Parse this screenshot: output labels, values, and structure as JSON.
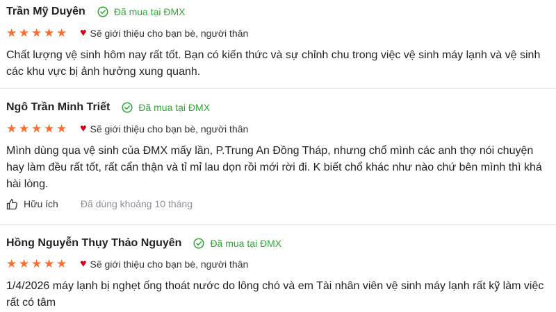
{
  "reviews": [
    {
      "name": "Trần Mỹ Duyên",
      "verified": "Đã mua tại ĐMX",
      "rating": 5,
      "recommend": "Sẽ giới thiệu cho bạn bè, người thân",
      "text": "Chất lượng vệ sinh hôm nay rất tốt. Bạn có kiến thức và sự chỉnh chu trong việc vệ sinh máy lạnh và vệ sinh\ncác khu vực bị ảnh hưởng xung quanh."
    },
    {
      "name": "Ngô Trần Minh Triết",
      "verified": "Đã mua tại ĐMX",
      "rating": 5,
      "recommend": "Sẽ giới thiệu cho bạn bè, người thân",
      "text": "Mình dùng qua vệ sinh của ĐMX mấy lần, P.Trung An Đồng Tháp, nhưng chổ mình các anh thợ nói chuyện hay làm đều rất tốt, rất cẩn thận và tỉ mỉ lau dọn rồi mới rời đi. K biết chổ khác như nào chứ bên mình thì khá hài lòng.",
      "helpful_label": "Hữu ích",
      "usage": "Đã dùng khoảng 10 tháng"
    },
    {
      "name": "Hồng Nguyễn Thụy Thảo Nguyên",
      "verified": "Đã mua tại ĐMX",
      "rating": 5,
      "recommend": "Sẽ giới thiệu cho bạn bè, người thân",
      "text": "1/4/2026 máy lạnh bị nghẹt ống thoát nước do lông chó và em Tài nhân viên vệ sinh máy lạnh rất kỹ làm việc rất có tâm"
    }
  ],
  "icons": {
    "verified": "check-circle-icon",
    "star": "star-icon",
    "heart": "heart-icon",
    "helpful": "thumbs-up-icon"
  },
  "colors": {
    "verified": "#2ba832",
    "star": "#fb6e2e",
    "heart": "#d0021b",
    "muted": "#8a8f96"
  }
}
